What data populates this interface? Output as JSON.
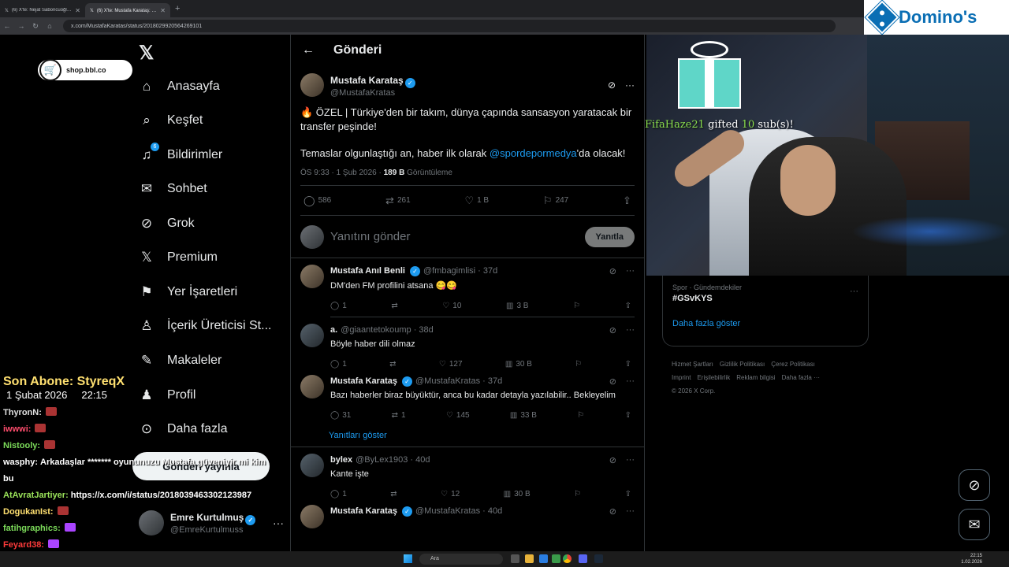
{
  "browser": {
    "tabs": [
      {
        "title": "(6) X'te: Nejat Saboncuoğlu: \"Gala...",
        "active": false
      },
      {
        "title": "(6) X'te: Mustafa Karataş: \"🔥 ÖZEL...",
        "active": true
      }
    ],
    "url": "x.com/MustafaKaratas/status/2018029920564269101"
  },
  "nav": {
    "items": [
      {
        "label": "Anasayfa",
        "icon": "home-icon"
      },
      {
        "label": "Keşfet",
        "icon": "search-icon"
      },
      {
        "label": "Bildirimler",
        "icon": "bell-icon",
        "badge": "6"
      },
      {
        "label": "Sohbet",
        "icon": "mail-icon"
      },
      {
        "label": "Grok",
        "icon": "grok-icon"
      },
      {
        "label": "Premium",
        "icon": "x-icon"
      },
      {
        "label": "Yer İşaretleri",
        "icon": "bookmark-icon"
      },
      {
        "label": "İçerik Üreticisi St...",
        "icon": "creator-icon"
      },
      {
        "label": "Makaleler",
        "icon": "article-icon"
      },
      {
        "label": "Profil",
        "icon": "person-icon"
      },
      {
        "label": "Daha fazla",
        "icon": "more-icon"
      }
    ],
    "post_button": "Gönderi yayınla",
    "account": {
      "name": "Emre Kurtulmuş",
      "handle": "@EmreKurtulmuss"
    }
  },
  "main": {
    "title": "Gönderi",
    "focus": {
      "name": "Mustafa Karataş",
      "handle": "@MustafaKratas",
      "text1": "🔥 ÖZEL | Türkiye'den bir takım, dünya çapında sansasyon yaratacak bir transfer peşinde!",
      "text2_pre": "Temaslar olgunlaştığı an, haber ilk olarak ",
      "mention": "@spordepormedya",
      "text2_post": "'da olacak!",
      "time": "ÖS 9:33 · 1 Şub 2026 · ",
      "views": "189 B",
      "views_label": " Görüntüleme",
      "replies": "586",
      "reposts": "261",
      "likes": "1 B",
      "bookmarks": "247"
    },
    "reply_placeholder": "Yanıtını gönder",
    "reply_button": "Yanıtla",
    "tweets": [
      {
        "name": "Mustafa Anıl Benli",
        "verified": true,
        "handle": "@fmbagimlisi · 37d",
        "text": "DM'den FM profilini atsana 😋😋",
        "replies": "1",
        "reposts": "",
        "likes": "10",
        "views": "3 B"
      },
      {
        "name": "a.",
        "verified": false,
        "handle": "@giaantetokoump · 38d",
        "text": "Böyle haber dili olmaz",
        "replies": "1",
        "reposts": "",
        "likes": "127",
        "views": "30 B"
      },
      {
        "name": "Mustafa Karataş",
        "verified": true,
        "handle": "@MustafaKratas · 37d",
        "text": "Bazı haberler biraz büyüktür, anca bu kadar detayla yazılabilir.. Bekleyelim",
        "replies": "31",
        "reposts": "1",
        "likes": "145",
        "views": "33 B"
      },
      {
        "name": "bylex",
        "verified": false,
        "handle": "@ByLex1903 · 40d",
        "text": "Kante işte",
        "replies": "1",
        "reposts": "",
        "likes": "12",
        "views": "30 B"
      },
      {
        "name": "Mustafa Karataş",
        "verified": true,
        "handle": "@MustafaKratas · 40d",
        "text": "",
        "replies": "",
        "reposts": "",
        "likes": "",
        "views": ""
      }
    ],
    "show_replies": "Yanıtları göster"
  },
  "right": {
    "trend_category": "Spor · Gündemdekiler",
    "trend_name": "#GSvKYS",
    "show_more": "Daha fazla göster",
    "footer": [
      "Hizmet Şartları",
      "Gizlilik Politikası",
      "Çerez Politikası",
      "Imprint",
      "Erişilebilirlik",
      "Reklam bilgisi",
      "Daha fazla ···",
      "© 2026 X Corp."
    ]
  },
  "overlay": {
    "shop": "shop.bbl.co",
    "sponsor": "Domino's",
    "gifted_name": "FifaHaze21",
    "gifted_word": "gifted",
    "gifted_count": "10",
    "gifted_unit": "sub(s)!",
    "last_sub_label": "Son Abone: StyreqX",
    "date": "1 Şubat 2026",
    "time": "22:15"
  },
  "chat": [
    {
      "user": "ThyronN:",
      "msg": "",
      "color": "#e0e0e0"
    },
    {
      "user": "iwwwi:",
      "msg": "",
      "color": "#ff4d6d"
    },
    {
      "user": "Nistooly:",
      "msg": "",
      "color": "#7cdb5a"
    },
    {
      "user": "wasphy:",
      "msg": "Arkadaşlar ******* oyununuzu Mustafa güveniyir mi kim",
      "color": "#ffffff"
    },
    {
      "user": "",
      "msg": "bu",
      "color": "#ffffff"
    },
    {
      "user": "AtAvratJartiyer:",
      "msg": "https://x.com/i/status/2018039463302123987",
      "color": "#9be35a"
    },
    {
      "user": "DogukanIst:",
      "msg": "",
      "color": "#ffe070"
    },
    {
      "user": "fatihgraphics:",
      "msg": "",
      "color": "#7cdb5a"
    },
    {
      "user": "Feyard38:",
      "msg": "",
      "color": "#ff3b3b"
    }
  ],
  "taskbar": {
    "search": "Ara",
    "time": "22:15",
    "date": "1.02.2026"
  }
}
